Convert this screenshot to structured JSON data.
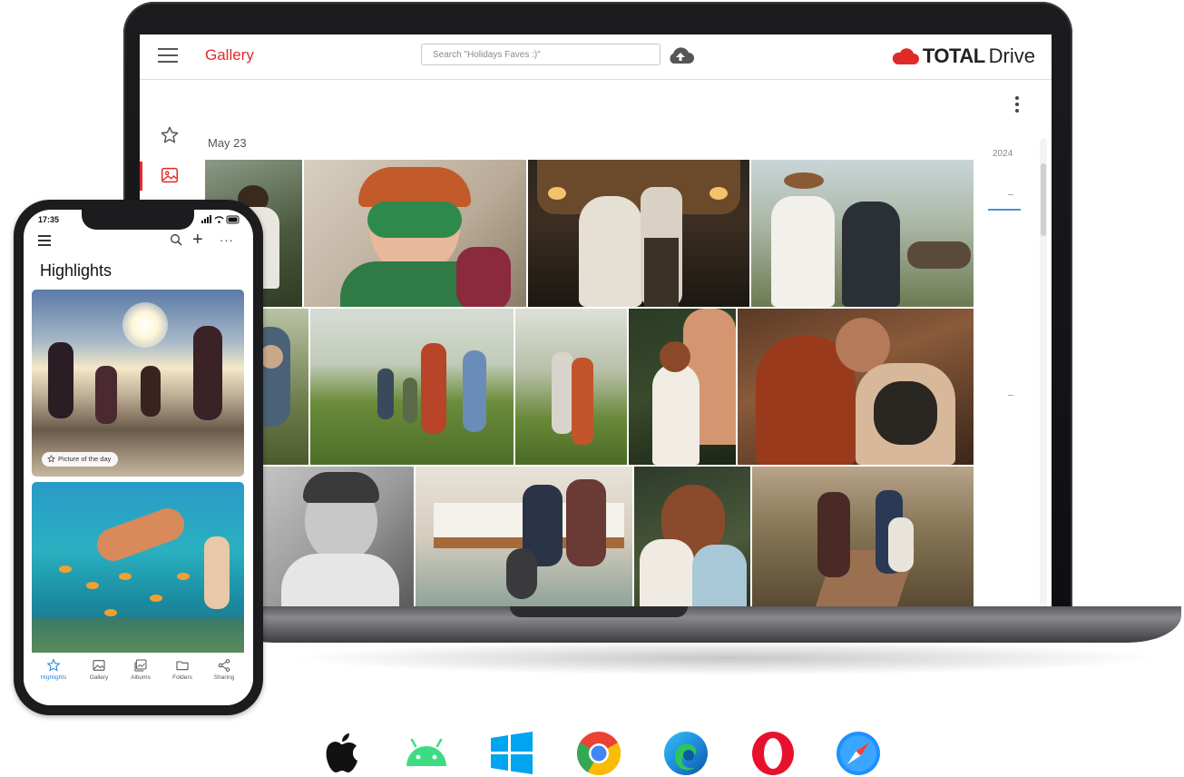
{
  "desktop": {
    "app_title": "Gallery",
    "search_placeholder": "Search \"Holidays Faves :)\"",
    "brand_total": "TOTAL",
    "brand_drive": "Drive",
    "date_group": "May 23",
    "timeline_year": "2024",
    "accent_color": "#e02a2a"
  },
  "phone": {
    "time": "17:35",
    "title": "Highlights",
    "picture_of_the_day": "Picture of the day",
    "tabs": [
      {
        "label": "Highlights",
        "icon": "star-icon",
        "active": true
      },
      {
        "label": "Gallery",
        "icon": "image-icon",
        "active": false
      },
      {
        "label": "Albums",
        "icon": "album-icon",
        "active": false
      },
      {
        "label": "Folders",
        "icon": "folder-icon",
        "active": false
      },
      {
        "label": "Sharing",
        "icon": "share-icon",
        "active": false
      }
    ]
  },
  "platforms": [
    "apple-icon",
    "android-icon",
    "windows-icon",
    "chrome-icon",
    "edge-icon",
    "opera-icon",
    "safari-icon"
  ]
}
